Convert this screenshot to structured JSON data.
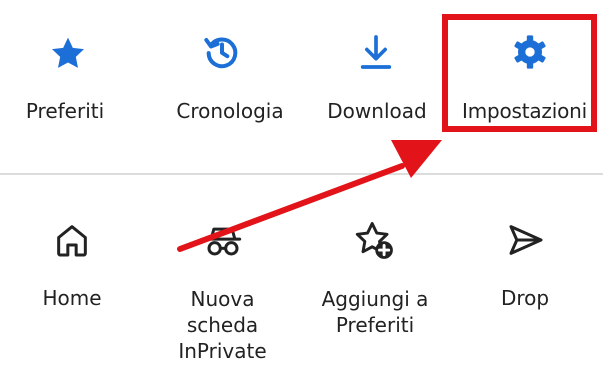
{
  "top_row": {
    "items": [
      {
        "label": "Preferiti",
        "icon": "star-icon"
      },
      {
        "label": "Cronologia",
        "icon": "history-icon"
      },
      {
        "label": "Download",
        "icon": "download-icon"
      },
      {
        "label": "Impostazioni",
        "icon": "gear-icon"
      }
    ],
    "icon_color": "#1b6fd6"
  },
  "bottom_row": {
    "items": [
      {
        "label": "Home",
        "icon": "home-icon"
      },
      {
        "label_lines": [
          "Nuova",
          "scheda",
          "InPrivate"
        ],
        "icon": "inprivate-icon"
      },
      {
        "label_lines": [
          "Aggiungi a",
          "Preferiti"
        ],
        "icon": "add-favorite-icon"
      },
      {
        "label": "Drop",
        "icon": "send-icon"
      }
    ]
  },
  "annotation": {
    "color": "#e2141a"
  }
}
